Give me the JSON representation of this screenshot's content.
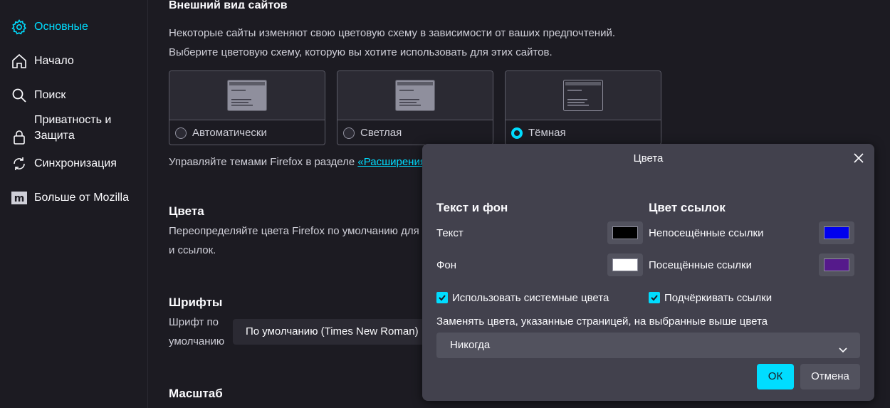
{
  "sidebar": {
    "items": [
      {
        "label": "Основные",
        "icon": "gear-icon",
        "active": true
      },
      {
        "label": "Начало",
        "icon": "home-icon"
      },
      {
        "label": "Поиск",
        "icon": "search-icon"
      },
      {
        "label_line1": "Приватность и",
        "label_line2": "Защита",
        "icon": "lock-icon"
      },
      {
        "label": "Синхронизация",
        "icon": "sync-icon"
      },
      {
        "label": "Больше от Mozilla",
        "icon": "mozilla-icon"
      }
    ]
  },
  "main": {
    "appearance": {
      "heading": "Внешний вид сайтов",
      "desc_line1": "Некоторые сайты изменяют свою цветовую схему в зависимости от ваших предпочтений.",
      "desc_line2": "Выберите цветовую схему, которую вы хотите использовать для этих сайтов.",
      "options": [
        {
          "label": "Автоматически",
          "selected": false
        },
        {
          "label": "Светлая",
          "selected": false
        },
        {
          "label": "Тёмная",
          "selected": true
        }
      ],
      "themes_text": "Управляйте темами Firefox в разделе ",
      "themes_link": "«Расширения"
    },
    "colors": {
      "title": "Цвета",
      "desc_line1": "Переопределяйте цвета Firefox по умолчанию для",
      "desc_line2": "и ссылок."
    },
    "fonts": {
      "title": "Шрифты",
      "label_line1": "Шрифт по",
      "label_line2": "умолчанию",
      "value": "По умолчанию (Times New Roman)"
    },
    "zoom": {
      "title": "Масштаб"
    }
  },
  "dialog": {
    "title": "Цвета",
    "text_bg": {
      "heading": "Текст и фон",
      "text_label": "Текст",
      "bg_label": "Фон",
      "text_color": "#000000",
      "bg_color": "#ffffff",
      "use_system": "Использовать системные цвета"
    },
    "links": {
      "heading": "Цвет ссылок",
      "unvisited_label": "Непосещённые ссылки",
      "visited_label": "Посещённые ссылки",
      "unvisited_color": "#0000ee",
      "visited_color": "#551a8b",
      "underline": "Подчёркивать ссылки"
    },
    "override_label": "Заменять цвета, указанные страницей, на выбранные выше цвета",
    "override_value": "Никогда",
    "ok": "ОК",
    "cancel": "Отмена"
  },
  "colors": {
    "accent": "#00ddff",
    "background": "#1c1b22",
    "dialog": "#42414d"
  }
}
